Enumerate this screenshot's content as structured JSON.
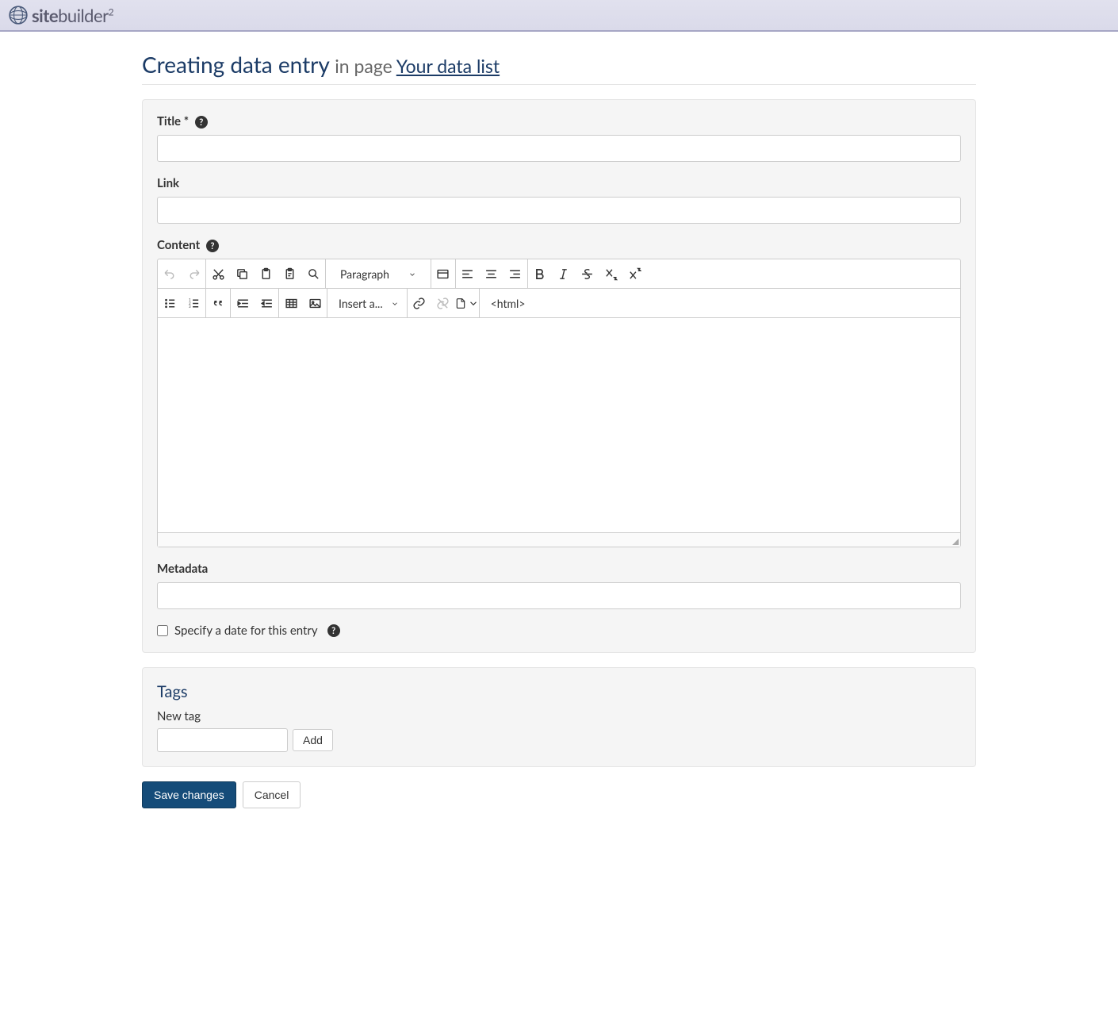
{
  "brand": {
    "name_bold": "site",
    "name_rest": "builder",
    "sup": "2"
  },
  "header": {
    "title": "Creating data entry",
    "in_page": "in page",
    "link_text": "Your data list"
  },
  "form": {
    "title_label": "Title *",
    "title_value": "",
    "link_label": "Link",
    "link_value": "",
    "content_label": "Content",
    "metadata_label": "Metadata",
    "metadata_value": "",
    "date_checkbox_label": "Specify a date for this entry"
  },
  "editor": {
    "paragraph_label": "Paragraph",
    "insert_label": "Insert a...",
    "html_label": "<html>"
  },
  "tags": {
    "section_title": "Tags",
    "new_tag_label": "New tag",
    "add_btn": "Add",
    "new_tag_value": ""
  },
  "actions": {
    "save": "Save changes",
    "cancel": "Cancel"
  }
}
